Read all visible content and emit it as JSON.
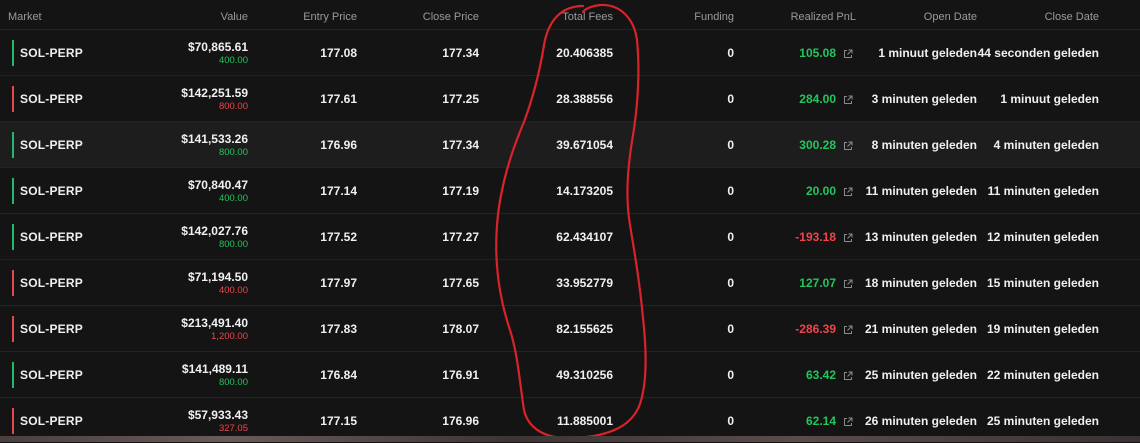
{
  "columns": {
    "market": "Market",
    "value": "Value",
    "entry_price": "Entry Price",
    "close_price": "Close Price",
    "total_fees": "Total Fees",
    "funding": "Funding",
    "realized_pnl": "Realized PnL",
    "open_date": "Open Date",
    "close_date": "Close Date"
  },
  "colors": {
    "long": "#22c55e",
    "short": "#f0444a",
    "annotation": "#d8232a"
  },
  "icons": {
    "pnl_link": "external-link-icon"
  },
  "rows": [
    {
      "market": "SOL-PERP",
      "side": "long",
      "value": "$70,865.61",
      "size": "400.00",
      "entry": "177.08",
      "close": "177.34",
      "fees": "20.406385",
      "funding": "0",
      "pnl": "105.08",
      "pnl_sign": "pos",
      "open": "1 minuut geleden",
      "closed": "44 seconden geleden"
    },
    {
      "market": "SOL-PERP",
      "side": "short",
      "value": "$142,251.59",
      "size": "800.00",
      "entry": "177.61",
      "close": "177.25",
      "fees": "28.388556",
      "funding": "0",
      "pnl": "284.00",
      "pnl_sign": "pos",
      "open": "3 minuten geleden",
      "closed": "1 minuut geleden"
    },
    {
      "market": "SOL-PERP",
      "side": "long",
      "value": "$141,533.26",
      "size": "800.00",
      "entry": "176.96",
      "close": "177.34",
      "fees": "39.671054",
      "funding": "0",
      "pnl": "300.28",
      "pnl_sign": "pos",
      "open": "8 minuten geleden",
      "closed": "4 minuten geleden"
    },
    {
      "market": "SOL-PERP",
      "side": "long",
      "value": "$70,840.47",
      "size": "400.00",
      "entry": "177.14",
      "close": "177.19",
      "fees": "14.173205",
      "funding": "0",
      "pnl": "20.00",
      "pnl_sign": "pos",
      "open": "11 minuten geleden",
      "closed": "11 minuten geleden"
    },
    {
      "market": "SOL-PERP",
      "side": "long",
      "value": "$142,027.76",
      "size": "800.00",
      "entry": "177.52",
      "close": "177.27",
      "fees": "62.434107",
      "funding": "0",
      "pnl": "-193.18",
      "pnl_sign": "neg",
      "open": "13 minuten geleden",
      "closed": "12 minuten geleden"
    },
    {
      "market": "SOL-PERP",
      "side": "short",
      "value": "$71,194.50",
      "size": "400.00",
      "entry": "177.97",
      "close": "177.65",
      "fees": "33.952779",
      "funding": "0",
      "pnl": "127.07",
      "pnl_sign": "pos",
      "open": "18 minuten geleden",
      "closed": "15 minuten geleden"
    },
    {
      "market": "SOL-PERP",
      "side": "short",
      "value": "$213,491.40",
      "size": "1,200.00",
      "entry": "177.83",
      "close": "178.07",
      "fees": "82.155625",
      "funding": "0",
      "pnl": "-286.39",
      "pnl_sign": "neg",
      "open": "21 minuten geleden",
      "closed": "19 minuten geleden"
    },
    {
      "market": "SOL-PERP",
      "side": "long",
      "value": "$141,489.11",
      "size": "800.00",
      "entry": "176.84",
      "close": "176.91",
      "fees": "49.310256",
      "funding": "0",
      "pnl": "63.42",
      "pnl_sign": "pos",
      "open": "25 minuten geleden",
      "closed": "22 minuten geleden"
    },
    {
      "market": "SOL-PERP",
      "side": "short",
      "value": "$57,933.43",
      "size": "327.05",
      "entry": "177.15",
      "close": "176.96",
      "fees": "11.885001",
      "funding": "0",
      "pnl": "62.14",
      "pnl_sign": "pos",
      "open": "26 minuten geleden",
      "closed": "25 minuten geleden"
    }
  ]
}
